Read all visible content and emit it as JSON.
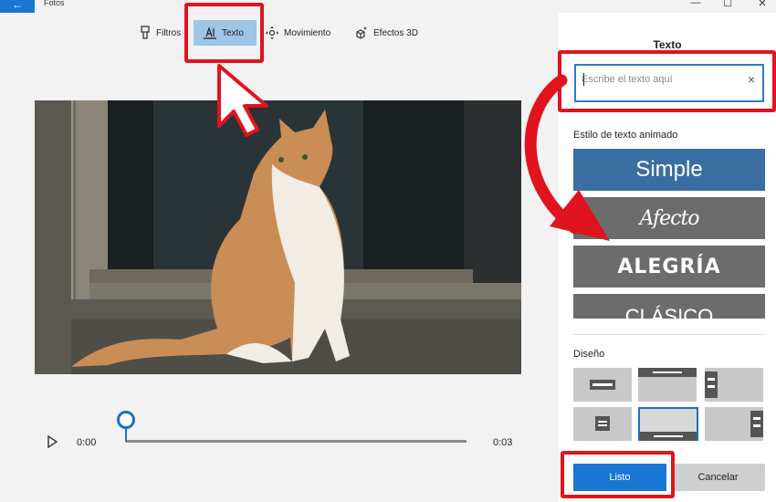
{
  "window": {
    "app_title": "Fotos",
    "back_icon": "←",
    "minimize_icon": "—",
    "maximize_icon": "☐",
    "close_icon": "✕"
  },
  "toolbar": {
    "items": [
      {
        "label": "Filtros",
        "icon": "filter-icon"
      },
      {
        "label": "Texto",
        "icon": "text-icon",
        "active": true
      },
      {
        "label": "Movimiento",
        "icon": "motion-icon"
      },
      {
        "label": "Efectos 3D",
        "icon": "3d-effects-icon"
      }
    ]
  },
  "playback": {
    "current_time": "0:00",
    "total_time": "0:03",
    "progress": 0
  },
  "panel": {
    "title": "Texto",
    "text_input": {
      "value": "",
      "placeholder": "Escribe el texto aquí",
      "clear_icon": "×"
    },
    "animated_style_label": "Estilo de texto animado",
    "styles": [
      "Simple",
      "Afecto",
      "ALEGRÍA",
      "CLÁSICO"
    ],
    "selected_style": "Simple",
    "layout_label": "Diseño",
    "layouts_selected_index": 4,
    "done_button": "Listo",
    "cancel_button": "Cancelar"
  },
  "colors": {
    "accent": "#1976d2",
    "highlight_red": "#e0141e",
    "simple_style_bg": "#3a6ea0",
    "style_card_bg": "#6c6c6c"
  }
}
